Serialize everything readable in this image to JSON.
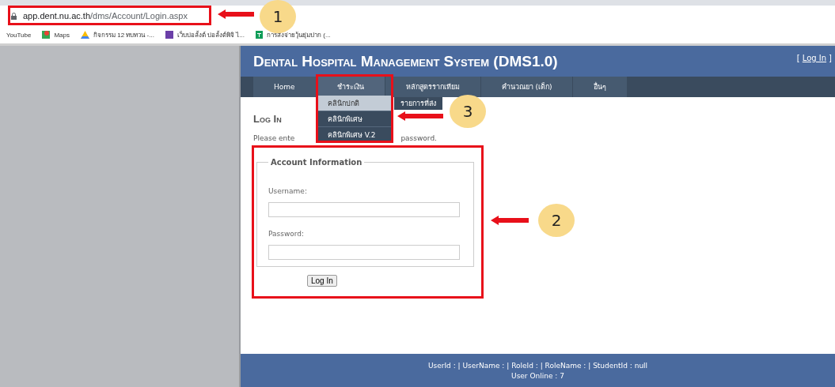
{
  "browser": {
    "url_host": "app.dent.nu.ac.th",
    "url_path": "/dms/Account/Login.aspx",
    "bookmarks": [
      {
        "label": "YouTube",
        "kind": "plain"
      },
      {
        "label": "Maps",
        "kind": "maps"
      },
      {
        "label": "กิจกรรม 12 ทบทวน -...",
        "kind": "drive"
      },
      {
        "label": "เว็บบ่อลั้งต์ บ่อลั้งต์พิจิ ไ...",
        "kind": "purple"
      },
      {
        "label": "การสั่งจ่ายวุ้นยุ่มปาก (...",
        "kind": "sheet"
      }
    ]
  },
  "header": {
    "title": "Dental Hospital Management System (DMS1.0)",
    "login": {
      "open": "[",
      "label": "Log In",
      "close": "]"
    }
  },
  "nav": {
    "items": [
      {
        "label": "Home",
        "selected": false
      },
      {
        "label": "ชำระเงิน",
        "selected": true
      },
      {
        "label": "หลักสูตรรากเทียม",
        "selected": false
      },
      {
        "label": "คำนวณยา (เด็ก)",
        "selected": false
      },
      {
        "label": "อื่นๆ",
        "selected": false
      }
    ],
    "submenu": {
      "label": "รายการที่ส่ง"
    },
    "dropdown": [
      {
        "label": "คลินิกปกติ",
        "selected": true
      },
      {
        "label": "คลินิกพิเศษ",
        "selected": false
      },
      {
        "label": "คลินิกพิเศษ V.2",
        "selected": false
      }
    ]
  },
  "login": {
    "heading": "Log In",
    "intro_start": "Please ente",
    "intro_end": "password.",
    "legend": "Account Information",
    "username_label": "Username:",
    "password_label": "Password:",
    "button": "Log In"
  },
  "footer": {
    "line1": "UserId : | UserName : | RoleId : | RoleName : | StudentId : null",
    "line2": "User Online : 7"
  },
  "annotations": [
    {
      "number": "1"
    },
    {
      "number": "2"
    },
    {
      "number": "3"
    }
  ]
}
